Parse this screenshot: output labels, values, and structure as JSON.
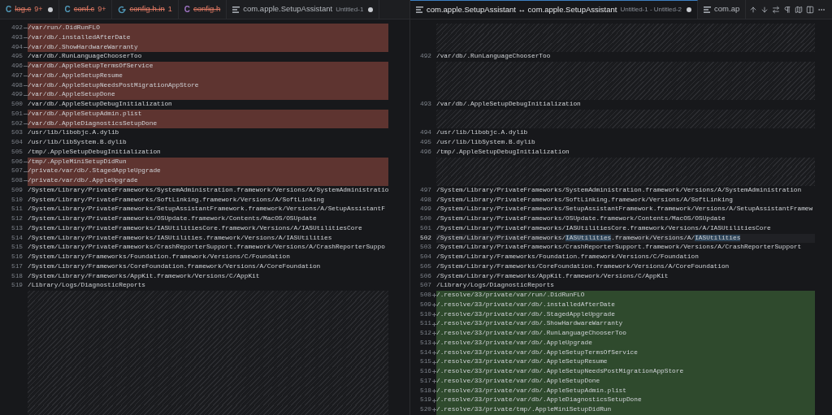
{
  "editor_groups": [
    {
      "tabs": [
        {
          "kind": "letter",
          "icon_text": "C",
          "color": "#519aba",
          "label": "log.c",
          "deleted": true,
          "badge": "9+",
          "dirty": true,
          "selected": false
        },
        {
          "kind": "letter",
          "icon_text": "C",
          "color": "#519aba",
          "label": "conf.c",
          "deleted": true,
          "badge": "9+",
          "dirty": false,
          "selected": false
        },
        {
          "kind": "config",
          "color": "#519aba",
          "label": "config.h.in",
          "deleted": true,
          "badge": "1",
          "dirty": false,
          "selected": false
        },
        {
          "kind": "letter",
          "icon_text": "C",
          "color": "#a074c4",
          "label": "config.h",
          "deleted": true,
          "dirty": false,
          "selected": false
        },
        {
          "kind": "lines",
          "label": "com.apple.SetupAssistant",
          "description": "Untitled-1",
          "deleted": false,
          "dirty": true,
          "selected": false
        }
      ],
      "lines": [
        {
          "kind": "removed",
          "number": "492",
          "text": "/var/run/.DidRunFLO",
          "current": false
        },
        {
          "kind": "removed",
          "number": "493",
          "text": "/var/db/.installedAfterDate",
          "current": false
        },
        {
          "kind": "removed",
          "number": "494",
          "text": "/var/db/.ShowHardwareWarranty",
          "current": false
        },
        {
          "kind": "normal",
          "number": "495",
          "text": "/var/db/.RunLanguageChooserToo",
          "current": false
        },
        {
          "kind": "removed",
          "number": "496",
          "text": "/var/db/.AppleSetupTermsOfService",
          "current": false
        },
        {
          "kind": "removed",
          "number": "497",
          "text": "/var/db/.AppleSetupResume",
          "current": false
        },
        {
          "kind": "removed",
          "number": "498",
          "text": "/var/db/.AppleSetupNeedsPostMigrationAppStore",
          "current": false
        },
        {
          "kind": "removed",
          "number": "499",
          "text": "/var/db/.AppleSetupDone",
          "current": false
        },
        {
          "kind": "normal",
          "number": "500",
          "text": "/var/db/.AppleSetupDebugInitialization",
          "current": false
        },
        {
          "kind": "removed",
          "number": "501",
          "text": "/var/db/.AppleSetupAdmin.plist",
          "current": false
        },
        {
          "kind": "removed",
          "number": "502",
          "text": "/var/db/.AppleDiagnosticsSetupDone",
          "current": false
        },
        {
          "kind": "normal",
          "number": "503",
          "text": "/usr/lib/libobjc.A.dylib",
          "current": false
        },
        {
          "kind": "normal",
          "number": "504",
          "text": "/usr/lib/libSystem.B.dylib",
          "current": false
        },
        {
          "kind": "normal",
          "number": "505",
          "text": "/tmp/.AppleSetupDebugInitialization",
          "current": false
        },
        {
          "kind": "removed",
          "number": "506",
          "text": "/tmp/.AppleMiniSetupDidRun",
          "current": false
        },
        {
          "kind": "removed",
          "number": "507",
          "text": "/private/var/db/.StagedAppleUpgrade",
          "current": false
        },
        {
          "kind": "removed",
          "number": "508",
          "text": "/private/var/db/.AppleUpgrade",
          "current": false
        },
        {
          "kind": "normal",
          "number": "509",
          "text": "/System/Library/PrivateFrameworks/SystemAdministration.framework/Versions/A/SystemAdministratio",
          "current": false
        },
        {
          "kind": "normal",
          "number": "510",
          "text": "/System/Library/PrivateFrameworks/SoftLinking.framework/Versions/A/SoftLinking",
          "current": false
        },
        {
          "kind": "normal",
          "number": "511",
          "text": "/System/Library/PrivateFrameworks/SetupAssistantFramework.framework/Versions/A/SetupAssistantF",
          "current": false
        },
        {
          "kind": "normal",
          "number": "512",
          "text": "/System/Library/PrivateFrameworks/OSUpdate.framework/Contents/MacOS/OSUpdate",
          "current": false
        },
        {
          "kind": "normal",
          "number": "513",
          "text": "/System/Library/PrivateFrameworks/IASUtilitiesCore.framework/Versions/A/IASUtilitiesCore",
          "current": false
        },
        {
          "kind": "normal",
          "number": "514",
          "text": "/System/Library/PrivateFrameworks/IASUtilities.framework/Versions/A/IASUtilities",
          "current": false
        },
        {
          "kind": "normal",
          "number": "515",
          "text": "/System/Library/PrivateFrameworks/CrashReporterSupport.framework/Versions/A/CrashReporterSuppo",
          "current": false
        },
        {
          "kind": "normal",
          "number": "516",
          "text": "/System/Library/Frameworks/Foundation.framework/Versions/C/Foundation",
          "current": false
        },
        {
          "kind": "normal",
          "number": "517",
          "text": "/System/Library/Frameworks/CoreFoundation.framework/Versions/A/CoreFoundation",
          "current": false
        },
        {
          "kind": "normal",
          "number": "518",
          "text": "/System/Library/Frameworks/AppKit.framework/Versions/C/AppKit",
          "current": false
        },
        {
          "kind": "normal",
          "number": "519",
          "text": "/Library/Logs/DiagnosticReports",
          "current": false
        },
        {
          "kind": "filler"
        },
        {
          "kind": "filler"
        },
        {
          "kind": "filler"
        },
        {
          "kind": "filler"
        },
        {
          "kind": "filler"
        },
        {
          "kind": "filler"
        },
        {
          "kind": "filler"
        },
        {
          "kind": "filler"
        },
        {
          "kind": "filler"
        },
        {
          "kind": "filler"
        },
        {
          "kind": "filler"
        },
        {
          "kind": "filler"
        },
        {
          "kind": "filler"
        }
      ]
    },
    {
      "tabs": [
        {
          "kind": "lines",
          "label": "com.apple.SetupAssistant ↔ com.apple.SetupAssistant",
          "description": "Untitled-1 - Untitled-2",
          "deleted": false,
          "dirty": true,
          "selected": true
        },
        {
          "kind": "lines",
          "label": "com.ap",
          "deleted": false,
          "dirty": false,
          "selected": false
        }
      ],
      "lines": [
        {
          "kind": "filler"
        },
        {
          "kind": "filler"
        },
        {
          "kind": "filler"
        },
        {
          "kind": "normal",
          "number": "492",
          "text": "/var/db/.RunLanguageChooserToo",
          "current": false
        },
        {
          "kind": "filler"
        },
        {
          "kind": "filler"
        },
        {
          "kind": "filler"
        },
        {
          "kind": "filler"
        },
        {
          "kind": "normal",
          "number": "493",
          "text": "/var/db/.AppleSetupDebugInitialization",
          "current": false
        },
        {
          "kind": "filler"
        },
        {
          "kind": "filler"
        },
        {
          "kind": "normal",
          "number": "494",
          "text": "/usr/lib/libobjc.A.dylib",
          "current": false
        },
        {
          "kind": "normal",
          "number": "495",
          "text": "/usr/lib/libSystem.B.dylib",
          "current": false
        },
        {
          "kind": "normal",
          "number": "496",
          "text": "/tmp/.AppleSetupDebugInitialization",
          "current": false
        },
        {
          "kind": "filler"
        },
        {
          "kind": "filler"
        },
        {
          "kind": "filler"
        },
        {
          "kind": "normal",
          "number": "497",
          "text": "/System/Library/PrivateFrameworks/SystemAdministration.framework/Versions/A/SystemAdministration",
          "current": false
        },
        {
          "kind": "normal",
          "number": "498",
          "text": "/System/Library/PrivateFrameworks/SoftLinking.framework/Versions/A/SoftLinking",
          "current": false
        },
        {
          "kind": "normal",
          "number": "499",
          "text": "/System/Library/PrivateFrameworks/SetupAssistantFramework.framework/Versions/A/SetupAssistantFramew",
          "current": false
        },
        {
          "kind": "normal",
          "number": "500",
          "text": "/System/Library/PrivateFrameworks/OSUpdate.framework/Contents/MacOS/OSUpdate",
          "current": false
        },
        {
          "kind": "normal",
          "number": "501",
          "text": "/System/Library/PrivateFrameworks/IASUtilitiesCore.framework/Versions/A/IASUtilitiesCore",
          "current": false
        },
        {
          "kind": "normal",
          "number": "502",
          "current": true,
          "parts": [
            {
              "text": "/System/Library/PrivateFrameworks/",
              "match": false
            },
            {
              "text": "IASUtilities",
              "match": true
            },
            {
              "text": ".framework/Versions/A/",
              "match": false
            },
            {
              "text": "IASUtilities",
              "match": true
            }
          ]
        },
        {
          "kind": "normal",
          "number": "503",
          "text": "/System/Library/PrivateFrameworks/CrashReporterSupport.framework/Versions/A/CrashReporterSupport",
          "current": false
        },
        {
          "kind": "normal",
          "number": "504",
          "text": "/System/Library/Frameworks/Foundation.framework/Versions/C/Foundation",
          "current": false
        },
        {
          "kind": "normal",
          "number": "505",
          "text": "/System/Library/Frameworks/CoreFoundation.framework/Versions/A/CoreFoundation",
          "current": false
        },
        {
          "kind": "normal",
          "number": "506",
          "text": "/System/Library/Frameworks/AppKit.framework/Versions/C/AppKit",
          "current": false
        },
        {
          "kind": "normal",
          "number": "507",
          "text": "/Library/Logs/DiagnosticReports",
          "current": false
        },
        {
          "kind": "added",
          "number": "508",
          "text": "/.resolve/33/private/var/run/.DidRunFLO",
          "current": false
        },
        {
          "kind": "added",
          "number": "509",
          "text": "/.resolve/33/private/var/db/.installedAfterDate",
          "current": false
        },
        {
          "kind": "added",
          "number": "510",
          "text": "/.resolve/33/private/var/db/.StagedAppleUpgrade",
          "current": false
        },
        {
          "kind": "added",
          "number": "511",
          "text": "/.resolve/33/private/var/db/.ShowHardwareWarranty",
          "current": false
        },
        {
          "kind": "added",
          "number": "512",
          "text": "/.resolve/33/private/var/db/.RunLanguageChooserToo",
          "current": false
        },
        {
          "kind": "added",
          "number": "513",
          "text": "/.resolve/33/private/var/db/.AppleUpgrade",
          "current": false
        },
        {
          "kind": "added",
          "number": "514",
          "text": "/.resolve/33/private/var/db/.AppleSetupTermsOfService",
          "current": false
        },
        {
          "kind": "added",
          "number": "515",
          "text": "/.resolve/33/private/var/db/.AppleSetupResume",
          "current": false
        },
        {
          "kind": "added",
          "number": "516",
          "text": "/.resolve/33/private/var/db/.AppleSetupNeedsPostMigrationAppStore",
          "current": false
        },
        {
          "kind": "added",
          "number": "517",
          "text": "/.resolve/33/private/var/db/.AppleSetupDone",
          "current": false
        },
        {
          "kind": "added",
          "number": "518",
          "text": "/.resolve/33/private/var/db/.AppleSetupAdmin.plist",
          "current": false
        },
        {
          "kind": "added",
          "number": "519",
          "text": "/.resolve/33/private/var/db/.AppleDiagnosticsSetupDone",
          "current": false
        },
        {
          "kind": "added",
          "number": "520",
          "text": "/.resolve/33/private/tmp/.AppleMiniSetupDidRun",
          "current": false
        }
      ]
    }
  ]
}
